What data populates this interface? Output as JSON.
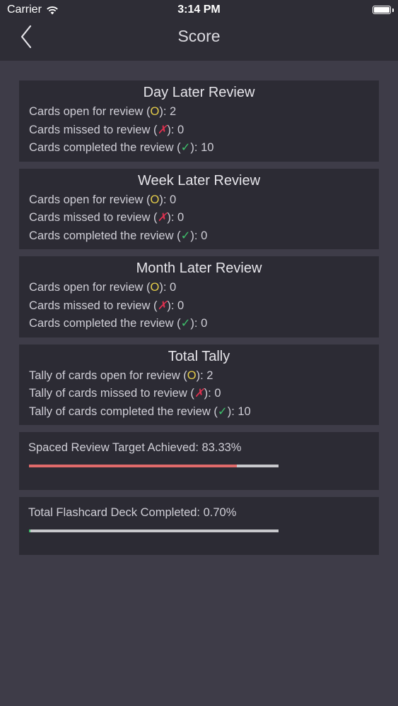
{
  "status_bar": {
    "carrier": "Carrier",
    "time": "3:14 PM"
  },
  "nav": {
    "title": "Score"
  },
  "sections": [
    {
      "title": "Day Later Review",
      "open_label": "Cards open for review (",
      "open_value": "): 2",
      "missed_label": "Cards missed to review (",
      "missed_value": "): 0",
      "done_label": "Cards completed the review (",
      "done_value": "): 10"
    },
    {
      "title": "Week Later Review",
      "open_label": "Cards open for review (",
      "open_value": "): 0",
      "missed_label": "Cards missed to review (",
      "missed_value": "): 0",
      "done_label": "Cards completed the review (",
      "done_value": "): 0"
    },
    {
      "title": "Month Later Review",
      "open_label": "Cards open for review (",
      "open_value": "): 0",
      "missed_label": "Cards missed to review (",
      "missed_value": "): 0",
      "done_label": "Cards completed the review (",
      "done_value": "): 0"
    },
    {
      "title": "Total Tally",
      "open_label": "Tally of cards open for review (",
      "open_value": "): 2",
      "missed_label": "Tally of cards missed to review (",
      "missed_value": "): 0",
      "done_label": "Tally of cards completed the review (",
      "done_value": "): 10"
    }
  ],
  "marks": {
    "open": "O",
    "missed": "✗",
    "done": "✓"
  },
  "progress": [
    {
      "label": "Spaced Review Target Achieved: 83.33%",
      "fraction": 0.8333,
      "color": "#e06a6a"
    },
    {
      "label": "Total Flashcard Deck Completed: 0.70%",
      "fraction": 0.007,
      "color": "#3fc06b"
    }
  ],
  "colors": {
    "background": "#3e3c48",
    "bar": "#2e2d36",
    "card": "#2c2b34",
    "open_mark": "#e5cd4a",
    "missed_mark": "#e0304f",
    "done_mark": "#3fc06b"
  },
  "icons": {
    "back": "chevron-left-icon",
    "wifi": "wifi-icon",
    "battery": "battery-icon"
  }
}
